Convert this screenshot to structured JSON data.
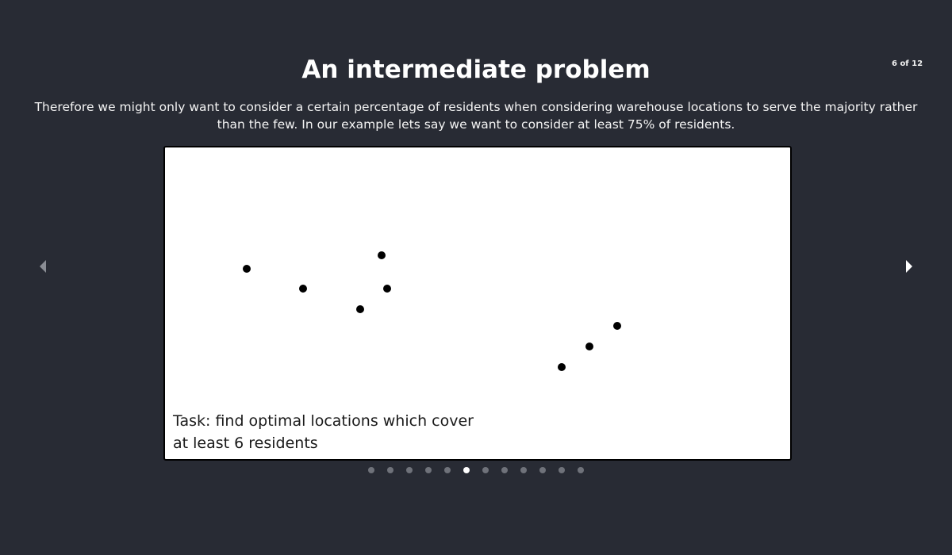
{
  "slide": {
    "counter": "6 of 12",
    "title": "An intermediate problem",
    "description": "Therefore we might only want to consider a certain percentage of residents when considering warehouse locations to serve the majority rather than the few. In our example lets say we want to consider at least 75% of residents.",
    "figure": {
      "task_line1": "Task: find optimal locations which cover",
      "task_line2": "at least 6 residents",
      "resident_count": 8
    }
  },
  "navigation": {
    "prev_icon": "chevron-left-icon",
    "next_icon": "chevron-right-icon",
    "total_slides": 12,
    "current_slide": 6
  },
  "colors": {
    "background": "#282b34",
    "dot_inactive": "#6f727a",
    "dot_active": "#ffffff",
    "arrow_left": "#8a8d94",
    "arrow_right": "#ffffff"
  }
}
